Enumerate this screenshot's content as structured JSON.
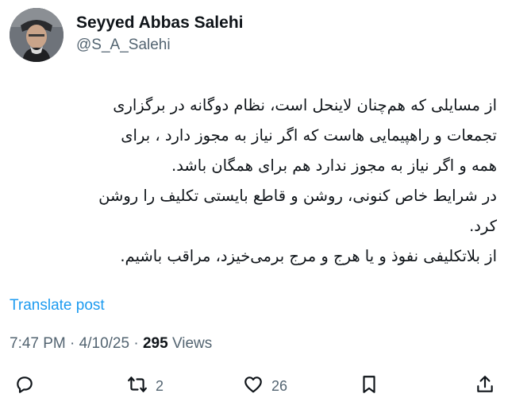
{
  "author": {
    "display_name": "Seyyed Abbas Salehi",
    "handle": "@S_A_Salehi"
  },
  "post": {
    "lines": [
      "از مسایلی که هم‌چنان لاینحل است، نظام دوگانه در برگزاری",
      "تجمعات و راهپیمایی هاست که اگر نیاز به مجوز دارد ، برای",
      "همه و اگر نیاز به مجوز ندارد هم برای همگان باشد.",
      " در شرایط خاص کنونی، روشن و قاطع بایستی تکلیف را روشن",
      "کرد.",
      "از بلاتکلیفی نفوذ و یا  هرج و مرج برمی‌خیزد، مراقب باشیم."
    ],
    "translate_label": "Translate post"
  },
  "meta": {
    "time": "7:47 PM",
    "separator": "·",
    "date": "4/10/25",
    "views_count": "295",
    "views_label": "Views"
  },
  "actions": {
    "reply_icon": "reply-icon",
    "retweet_icon": "retweet-icon",
    "retweet_count": "2",
    "like_icon": "heart-icon",
    "like_count": "26",
    "bookmark_icon": "bookmark-icon",
    "share_icon": "share-icon"
  },
  "colors": {
    "text": "#0f1419",
    "secondary": "#536471",
    "link": "#1d9bf0"
  }
}
